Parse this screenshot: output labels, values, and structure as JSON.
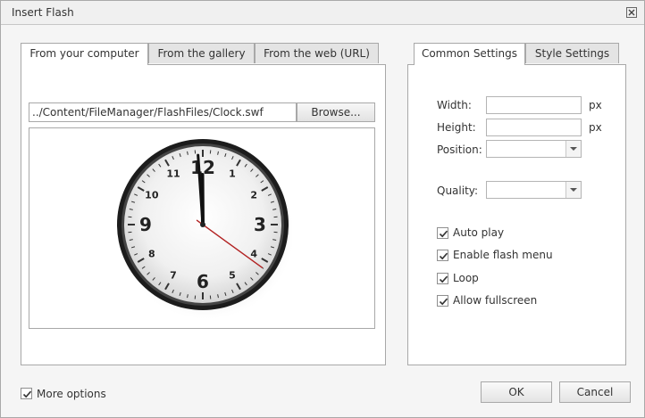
{
  "dialog": {
    "title": "Insert Flash",
    "close_icon": "close-icon"
  },
  "left_tabs": [
    {
      "label": "From your computer",
      "active": true
    },
    {
      "label": "From the gallery",
      "active": false
    },
    {
      "label": "From the web (URL)",
      "active": false
    }
  ],
  "file": {
    "path": "../Content/FileManager/FlashFiles/Clock.swf",
    "browse_label": "Browse..."
  },
  "clock": {
    "numerals": [
      "12",
      "1",
      "2",
      "3",
      "4",
      "5",
      "6",
      "7",
      "8",
      "9",
      "10",
      "11"
    ],
    "hour": 11,
    "minute": 59,
    "second": 21,
    "second_hand_color": "#b22222"
  },
  "right_tabs": [
    {
      "label": "Common Settings",
      "active": true
    },
    {
      "label": "Style Settings",
      "active": false
    }
  ],
  "settings": {
    "width_label": "Width:",
    "width_value": "",
    "height_label": "Height:",
    "height_value": "",
    "unit": "px",
    "position_label": "Position:",
    "position_value": "",
    "quality_label": "Quality:",
    "quality_value": "",
    "checkboxes": [
      {
        "label": "Auto play",
        "checked": true
      },
      {
        "label": "Enable flash menu",
        "checked": true
      },
      {
        "label": "Loop",
        "checked": true
      },
      {
        "label": "Allow fullscreen",
        "checked": true
      }
    ]
  },
  "footer": {
    "more_options_label": "More options",
    "more_options_checked": true,
    "ok_label": "OK",
    "cancel_label": "Cancel"
  }
}
